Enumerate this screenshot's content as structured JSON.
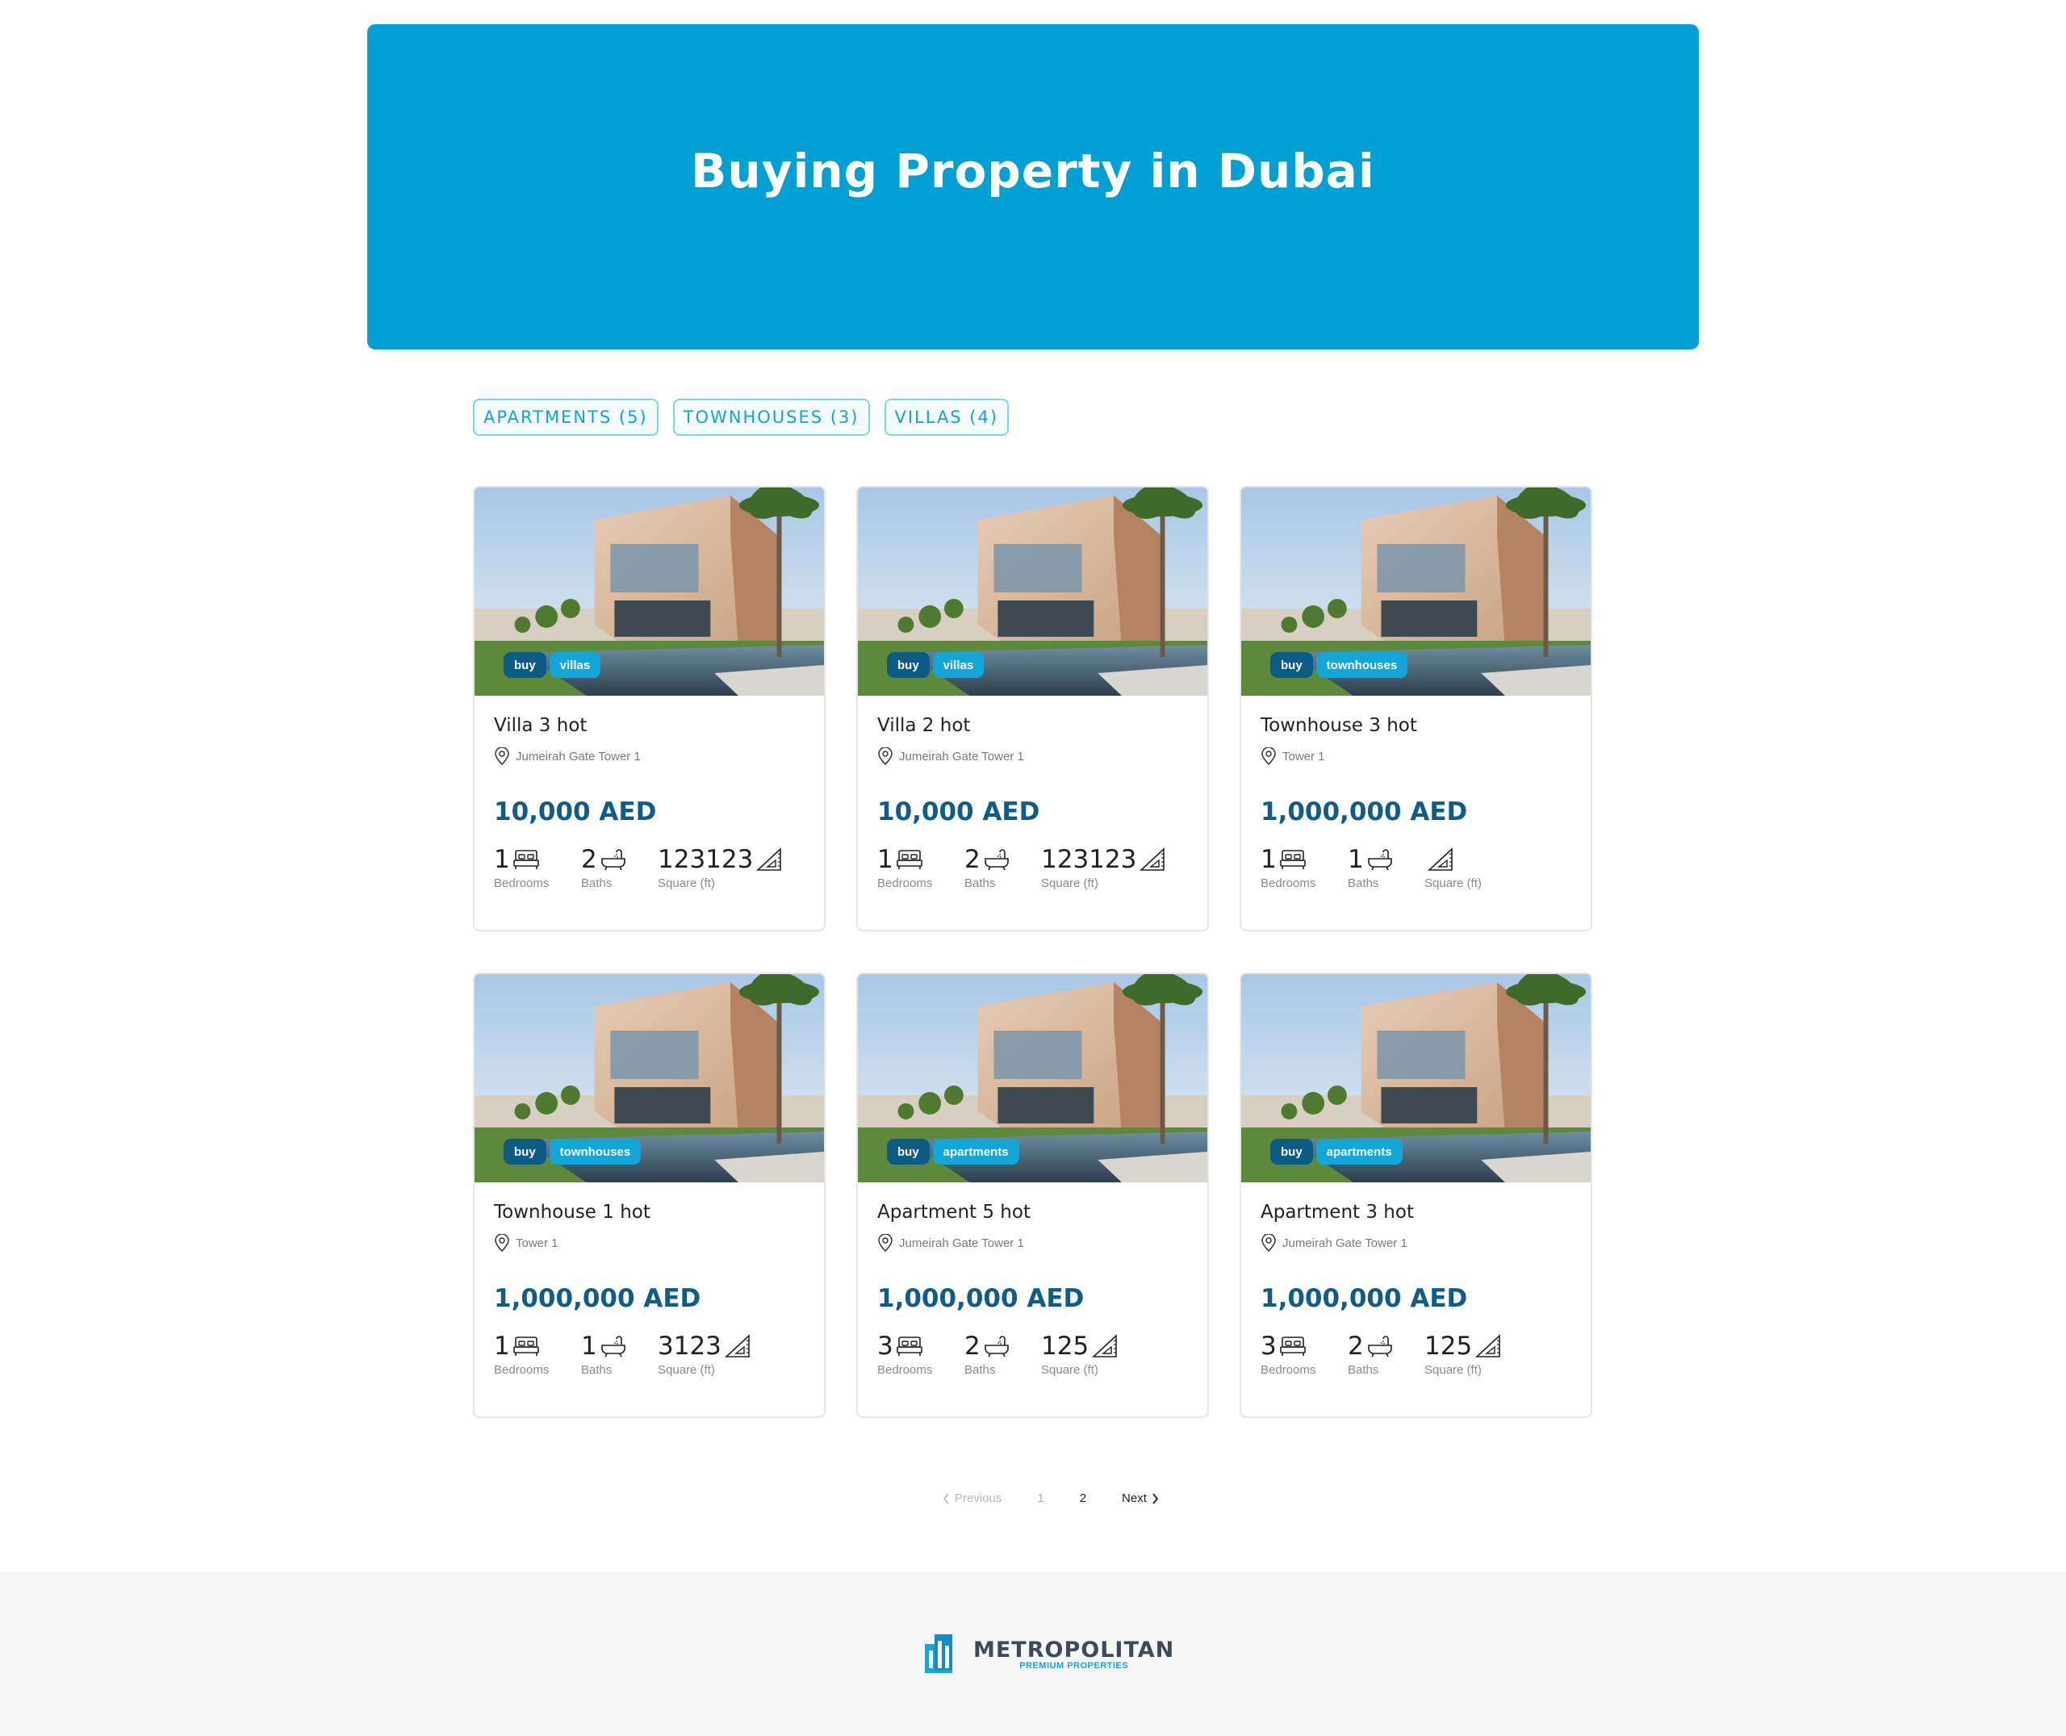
{
  "hero": {
    "title": "Buying Property in Dubai"
  },
  "filters": [
    {
      "label": "APARTMENTS (5)"
    },
    {
      "label": "TOWNHOUSES (3)"
    },
    {
      "label": "VILLAS (4)"
    }
  ],
  "listings": [
    {
      "tag_type": "buy",
      "tag_category": "villas",
      "title": "Villa 3 hot",
      "location": "Jumeirah Gate Tower 1",
      "price": "10,000 AED",
      "bedrooms": "1",
      "baths": "2",
      "area": "123123",
      "bedrooms_label": "Bedrooms",
      "baths_label": "Baths",
      "area_label": "Square (ft)"
    },
    {
      "tag_type": "buy",
      "tag_category": "villas",
      "title": "Villa 2 hot",
      "location": "Jumeirah Gate Tower 1",
      "price": "10,000 AED",
      "bedrooms": "1",
      "baths": "2",
      "area": "123123",
      "bedrooms_label": "Bedrooms",
      "baths_label": "Baths",
      "area_label": "Square (ft)"
    },
    {
      "tag_type": "buy",
      "tag_category": "townhouses",
      "title": "Townhouse 3 hot",
      "location": "Tower 1",
      "price": "1,000,000 AED",
      "bedrooms": "1",
      "baths": "1",
      "area": "",
      "bedrooms_label": "Bedrooms",
      "baths_label": "Baths",
      "area_label": "Square (ft)"
    },
    {
      "tag_type": "buy",
      "tag_category": "townhouses",
      "title": "Townhouse 1 hot",
      "location": "Tower 1",
      "price": "1,000,000 AED",
      "bedrooms": "1",
      "baths": "1",
      "area": "3123",
      "bedrooms_label": "Bedrooms",
      "baths_label": "Baths",
      "area_label": "Square (ft)"
    },
    {
      "tag_type": "buy",
      "tag_category": "apartments",
      "title": "Apartment 5 hot",
      "location": "Jumeirah Gate Tower 1",
      "price": "1,000,000 AED",
      "bedrooms": "3",
      "baths": "2",
      "area": "125",
      "bedrooms_label": "Bedrooms",
      "baths_label": "Baths",
      "area_label": "Square (ft)"
    },
    {
      "tag_type": "buy",
      "tag_category": "apartments",
      "title": "Apartment 3 hot",
      "location": "Jumeirah Gate Tower 1",
      "price": "1,000,000 AED",
      "bedrooms": "3",
      "baths": "2",
      "area": "125",
      "bedrooms_label": "Bedrooms",
      "baths_label": "Baths",
      "area_label": "Square (ft)"
    }
  ],
  "pagination": {
    "previous": "Previous",
    "pages": [
      "1",
      "2"
    ],
    "current": "2",
    "next": "Next"
  },
  "footer": {
    "logo_name": "METROPOLITAN",
    "logo_tagline": "PREMIUM PROPERTIES"
  },
  "icons": {
    "location": "map-pin-icon",
    "bed": "bed-icon",
    "bath": "bathtub-icon",
    "area": "set-square-icon",
    "prev": "chevron-left-icon",
    "next": "chevron-right-icon",
    "logo": "building-logo-icon"
  },
  "colors": {
    "hero_bg": "#00a0d4",
    "price": "#0f5b8a",
    "tag_buy": "#0c5a86",
    "tag_category": "#13a6d8",
    "filter_border": "#7ed4f0",
    "footer_bg": "#f6f6f6"
  }
}
